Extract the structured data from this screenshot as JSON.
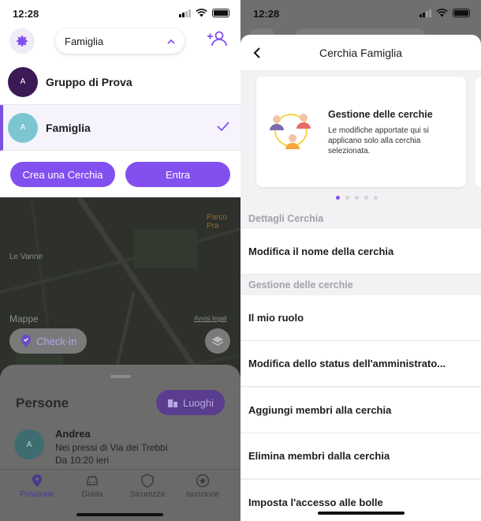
{
  "left": {
    "status": {
      "time": "12:28"
    },
    "circle_dropdown": {
      "selected": "Famiglia"
    },
    "circles": [
      {
        "initial": "A",
        "name": "Gruppo di Prova",
        "color": "#3b1a55"
      },
      {
        "initial": "A",
        "name": "Famiglia",
        "color": "#7cc6d2"
      }
    ],
    "buttons": {
      "create": "Crea una Cerchia",
      "join": "Entra"
    },
    "map": {
      "place1": "Le Vanne",
      "place2": "Parco Pra",
      "attribution": "Mappe",
      "legal": "Avvisi legali"
    },
    "checkin_label": "Check-in",
    "people": {
      "title": "Persone",
      "places_button": "Luoghi",
      "person": {
        "initial": "A",
        "name": "Andrea",
        "address": "Nei pressi di Via dei Trebbi",
        "time": "Da 10:20 ieri"
      }
    },
    "tabs": [
      "Posizione",
      "Guida",
      "Sicurezza",
      "Iscrizione"
    ]
  },
  "right": {
    "status": {
      "time": "12:28"
    },
    "header_title": "Cerchia Famiglia",
    "card": {
      "title": "Gestione delle cerchie",
      "description": "Le modifiche apportate qui si applicano solo alla cerchia selezionata."
    },
    "sections": [
      {
        "title": "Dettagli Cerchia",
        "rows": [
          "Modifica il nome della cerchia"
        ]
      },
      {
        "title": "Gestione delle cerchie",
        "rows": [
          "Il mio ruolo",
          "Modifica dello status dell'amministrato...",
          "Aggiungi membri alla cerchia",
          "Elimina membri dalla cerchia",
          "Imposta l'accesso alle bolle"
        ]
      }
    ]
  },
  "colors": {
    "accent": "#8350f0"
  }
}
